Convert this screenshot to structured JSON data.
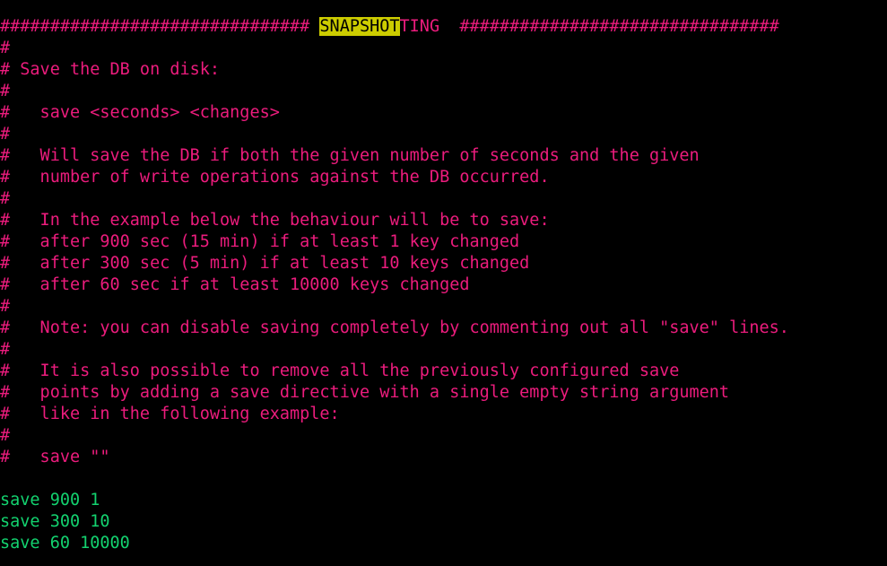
{
  "terminal": {
    "background_color": "#000000",
    "comment_color": "#ec1c7d",
    "directive_color": "#13d26f",
    "highlight_background": "#cccc00",
    "highlight_text_color": "#000000",
    "highlighted_term": "SNAPSHOT"
  },
  "lines": [
    {
      "kind": "comment",
      "segments": [
        {
          "text": "############################### ",
          "style": "pink"
        },
        {
          "text": "SNAPSHOT",
          "style": "highlight"
        },
        {
          "text": "TING  ################################",
          "style": "pink"
        }
      ]
    },
    {
      "kind": "comment",
      "text": "#"
    },
    {
      "kind": "comment",
      "text": "# Save the DB on disk:"
    },
    {
      "kind": "comment",
      "text": "#"
    },
    {
      "kind": "comment",
      "text": "#   save <seconds> <changes>"
    },
    {
      "kind": "comment",
      "text": "#"
    },
    {
      "kind": "comment",
      "text": "#   Will save the DB if both the given number of seconds and the given"
    },
    {
      "kind": "comment",
      "text": "#   number of write operations against the DB occurred."
    },
    {
      "kind": "comment",
      "text": "#"
    },
    {
      "kind": "comment",
      "text": "#   In the example below the behaviour will be to save:"
    },
    {
      "kind": "comment",
      "text": "#   after 900 sec (15 min) if at least 1 key changed"
    },
    {
      "kind": "comment",
      "text": "#   after 300 sec (5 min) if at least 10 keys changed"
    },
    {
      "kind": "comment",
      "text": "#   after 60 sec if at least 10000 keys changed"
    },
    {
      "kind": "comment",
      "text": "#"
    },
    {
      "kind": "comment",
      "text": "#   Note: you can disable saving completely by commenting out all \"save\" lines."
    },
    {
      "kind": "comment",
      "text": "#"
    },
    {
      "kind": "comment",
      "text": "#   It is also possible to remove all the previously configured save"
    },
    {
      "kind": "comment",
      "text": "#   points by adding a save directive with a single empty string argument"
    },
    {
      "kind": "comment",
      "text": "#   like in the following example:"
    },
    {
      "kind": "comment",
      "text": "#"
    },
    {
      "kind": "comment",
      "text": "#   save \"\""
    },
    {
      "kind": "blank",
      "text": ""
    },
    {
      "kind": "directive",
      "text": "save 900 1"
    },
    {
      "kind": "directive",
      "text": "save 300 10"
    },
    {
      "kind": "directive",
      "text": "save 60 10000"
    }
  ]
}
